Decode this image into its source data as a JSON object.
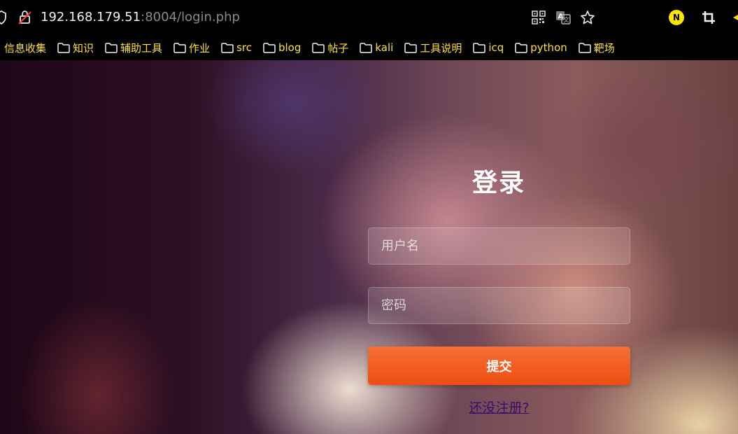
{
  "browser": {
    "url_host": "192.168.179.51",
    "url_rest": ":8004/login.php",
    "toolbar_icons": [
      "shield-icon",
      "insecure-lock-icon",
      "qr-code-icon",
      "translate-icon",
      "star-icon",
      "extension-n-icon",
      "crop-icon",
      "edge-icon"
    ],
    "extension_letter": "N"
  },
  "bookmarks": [
    {
      "label": "信息收集",
      "has_folder_icon": false
    },
    {
      "label": "知识",
      "has_folder_icon": true
    },
    {
      "label": "辅助工具",
      "has_folder_icon": true
    },
    {
      "label": "作业",
      "has_folder_icon": true
    },
    {
      "label": "src",
      "has_folder_icon": true
    },
    {
      "label": "blog",
      "has_folder_icon": true
    },
    {
      "label": "帖子",
      "has_folder_icon": true
    },
    {
      "label": "kali",
      "has_folder_icon": true
    },
    {
      "label": "工具说明",
      "has_folder_icon": true
    },
    {
      "label": "icq",
      "has_folder_icon": true
    },
    {
      "label": "python",
      "has_folder_icon": true
    },
    {
      "label": "靶场",
      "has_folder_icon": true
    }
  ],
  "login": {
    "title": "登录",
    "username_placeholder": "用户名",
    "password_placeholder": "密码",
    "submit_label": "提交",
    "register_link": "还没注册?"
  },
  "colors": {
    "bookmark_text": "#ffe135",
    "submit_button": "#f05a20",
    "register_link": "#3b0b6e"
  }
}
